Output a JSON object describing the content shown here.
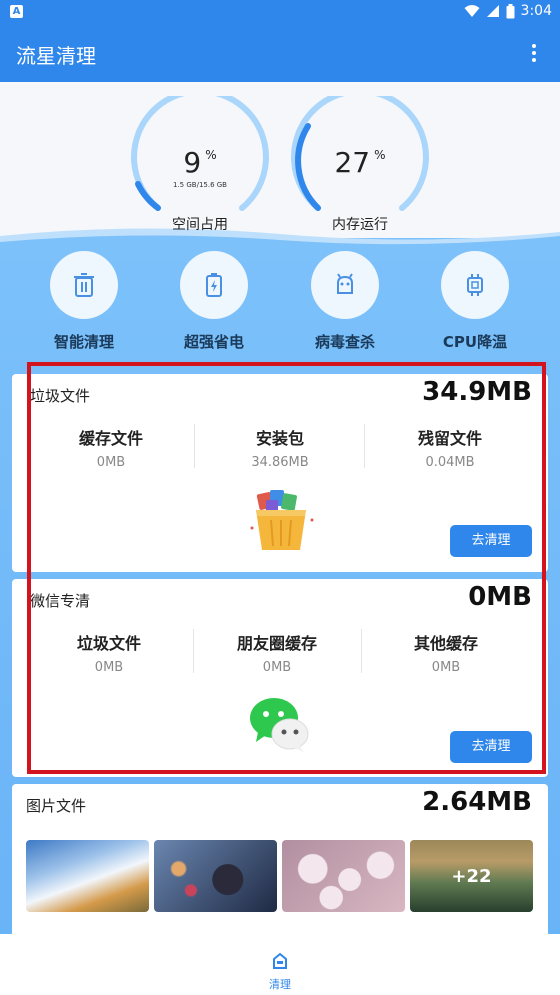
{
  "status_bar": {
    "time": "3:04"
  },
  "app_bar": {
    "title": "流星清理"
  },
  "gauges": [
    {
      "value": "9",
      "unit": "%",
      "detail": "1.5 GB/15.6 GB",
      "label": "空间占用",
      "percent": 9
    },
    {
      "value": "27",
      "unit": "%",
      "detail": "",
      "label": "内存运行",
      "percent": 27
    }
  ],
  "tools": [
    {
      "label": "智能清理",
      "icon": "trash-icon"
    },
    {
      "label": "超强省电",
      "icon": "battery-icon"
    },
    {
      "label": "病毒查杀",
      "icon": "android-icon"
    },
    {
      "label": "CPU降温",
      "icon": "chip-icon"
    }
  ],
  "junk_card": {
    "title": "垃圾文件",
    "size": "34.9MB",
    "stats": [
      {
        "name": "缓存文件",
        "value": "0MB"
      },
      {
        "name": "安装包",
        "value": "34.86MB"
      },
      {
        "name": "残留文件",
        "value": "0.04MB"
      }
    ],
    "button": "去清理"
  },
  "wechat_card": {
    "title": "微信专清",
    "size": "0MB",
    "stats": [
      {
        "name": "垃圾文件",
        "value": "0MB"
      },
      {
        "name": "朋友圈缓存",
        "value": "0MB"
      },
      {
        "name": "其他缓存",
        "value": "0MB"
      }
    ],
    "button": "去清理"
  },
  "image_card": {
    "title": "图片文件",
    "size": "2.64MB",
    "more_count": "+22"
  },
  "bottom_nav": {
    "label": "清理"
  },
  "colors": {
    "primary": "#2f86eb",
    "highlight": "#d3131d"
  }
}
